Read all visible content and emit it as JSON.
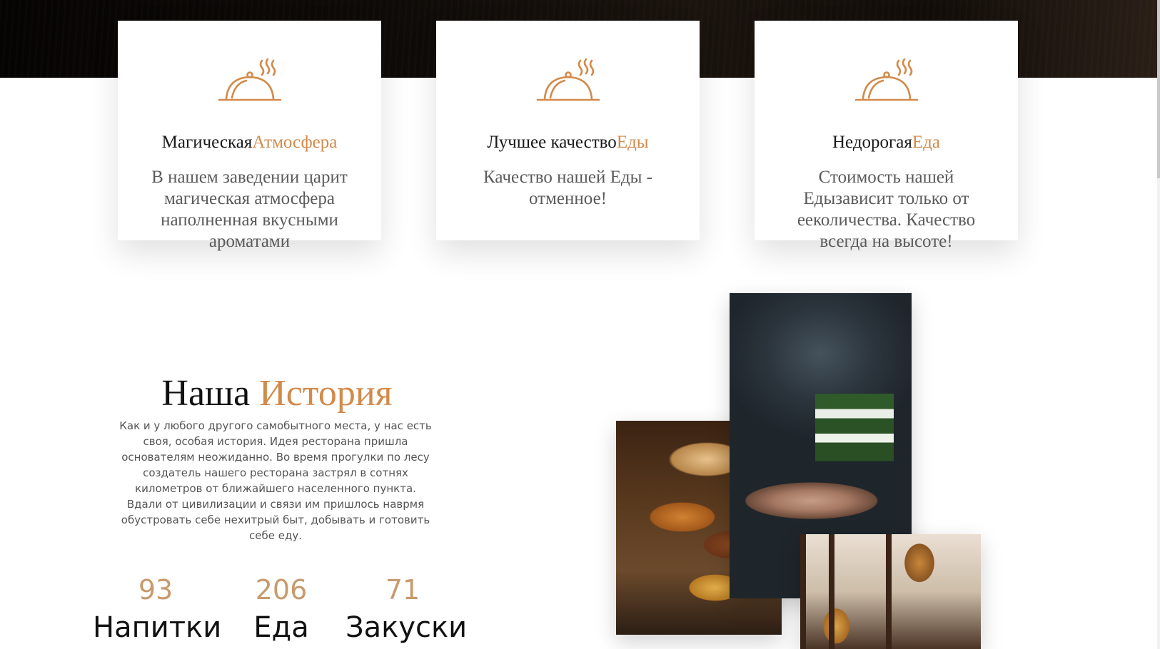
{
  "features": [
    {
      "title_main": "Магическая",
      "title_accent": "Атмосфера",
      "text": "В нашем заведении царит магическая атмосфера наполненная вкусными ароматами",
      "icon": "serving-dish-icon"
    },
    {
      "title_main": "Лучшее качество",
      "title_accent": "Еды",
      "text": "Качество нашей Еды - отменное!",
      "icon": "serving-dish-icon"
    },
    {
      "title_main": "Недорогая",
      "title_accent": "Еда",
      "text": "Стоимость нашей Едызависит только от ееколичества. Качество всегда на высоте!",
      "icon": "serving-dish-icon"
    }
  ],
  "history": {
    "title_main": "Наша",
    "title_accent": "История",
    "text": "Как и у любого другого самобытного места, у нас есть своя, особая история. Идея ресторана пришла основателям неожиданно. Во время прогулки по лесу создатель нашего ресторана застрял в сотнях километров от ближайшего населенного пункта. Вдали от цивилизации и связи им пришлось наврмя обустровать себе нехитрый быт, добывать и готовить себе еду."
  },
  "stats": [
    {
      "value": "93",
      "label": "Напитки"
    },
    {
      "value": "206",
      "label": "Еда"
    },
    {
      "value": "71",
      "label": "Закуски"
    }
  ],
  "colors": {
    "accent": "#d28a4a",
    "stat_number": "#c79a6c",
    "text_gray": "#5b5b5b"
  }
}
